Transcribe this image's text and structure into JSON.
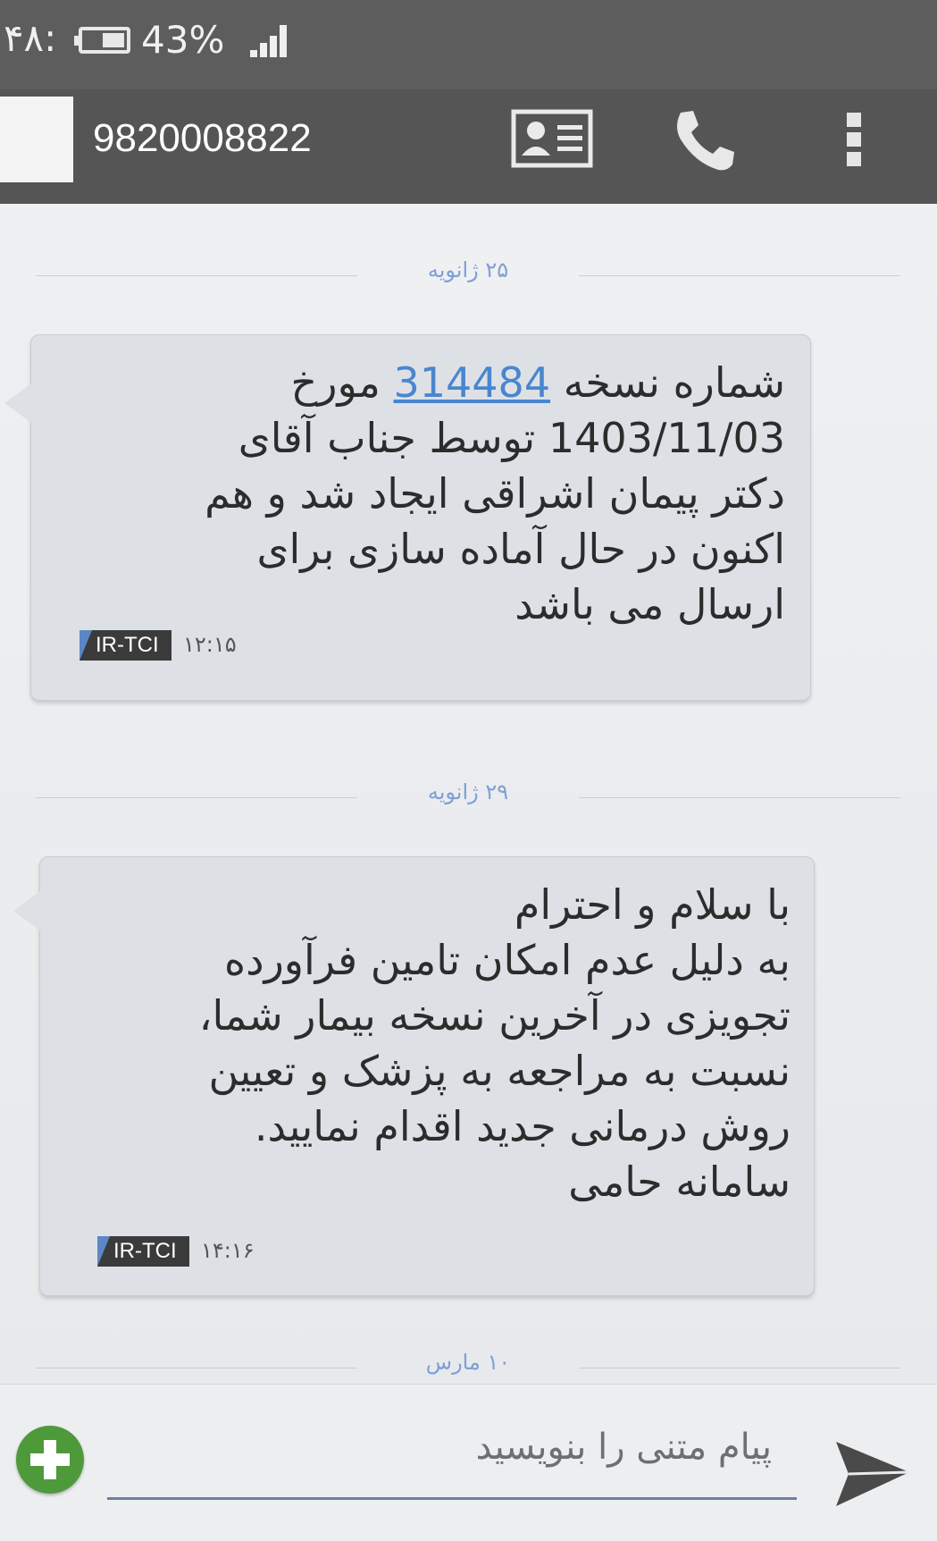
{
  "status_bar": {
    "time": "۴۸:",
    "battery": "43%"
  },
  "header": {
    "contact": "9820008822"
  },
  "messages": [
    {
      "date": "۲۵ ژانویه",
      "lines": [
        [
          "شماره نسخه ",
          "314484",
          " مورخ"
        ],
        [
          "1403/11/03 توسط جناب آقای"
        ],
        [
          "دکتر پیمان اشراقی ایجاد شد و هم"
        ],
        [
          "اکنون در حال آماده سازی برای"
        ],
        [
          "ارسال می باشد"
        ]
      ],
      "link": "314484",
      "badge": "IR-TCI",
      "time": "۱۲:۱۵"
    },
    {
      "date": "۲۹ ژانویه",
      "lines": [
        "با سلام و احترام",
        "به دلیل عدم امکان تامین فرآورده",
        "تجویزی در آخرین نسخه بیمار شما،",
        "نسبت به مراجعه به پزشک و تعیین",
        "روش درمانی  جدید اقدام نمایید.",
        "سامانه حامی"
      ],
      "badge": "IR-TCI",
      "time": "۱۴:۱۶"
    }
  ],
  "next_date": "۱۰ مارس",
  "composer": {
    "placeholder": "پیام متنی را بنویسید"
  },
  "colors": {
    "status_bar": "#5d5d5d",
    "header": "#555555",
    "bubble": "#dde1e6",
    "link": "#4a86cf",
    "date": "#7f9fd6",
    "attach": "#4e9a3a"
  }
}
